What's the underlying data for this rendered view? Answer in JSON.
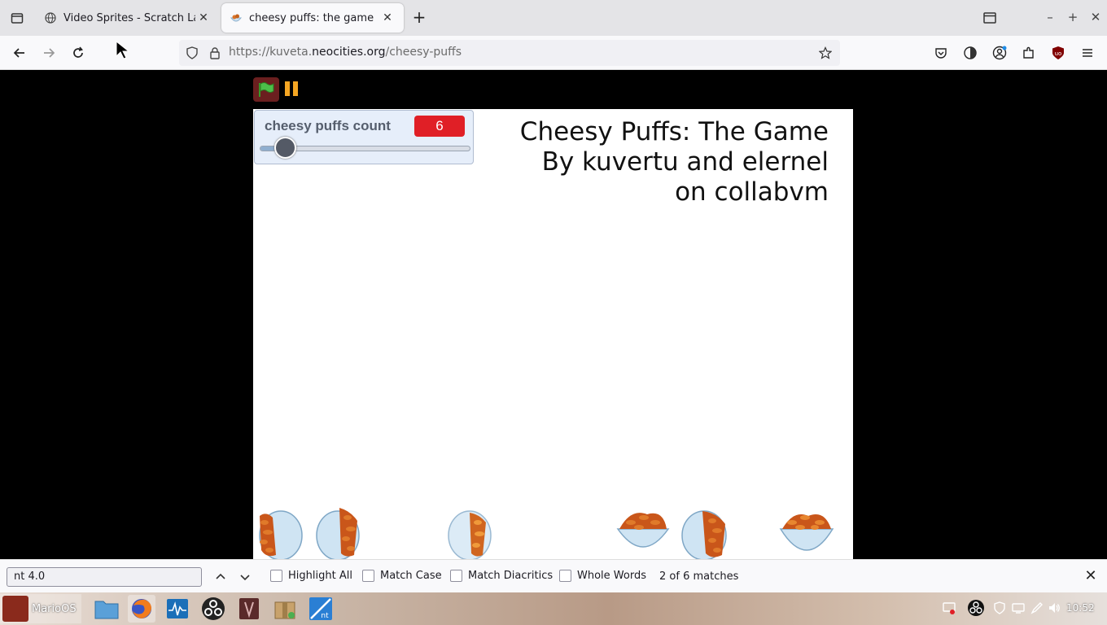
{
  "browser": {
    "tabs": [
      {
        "title": "Video Sprites - Scratch Lab",
        "active": false
      },
      {
        "title": "cheesy puffs: the game",
        "active": true
      }
    ],
    "url_scheme": "https://kuveta.",
    "url_host": "neocities.org",
    "url_path": "/cheesy-puffs"
  },
  "game": {
    "monitor_label": "cheesy puffs count",
    "monitor_value": "6",
    "slider_level": 0.1,
    "title_lines": [
      "Cheesy Puffs: The Game",
      "By kuvertu and elernel",
      "on collabvm"
    ]
  },
  "findbar": {
    "query": "nt 4.0",
    "options": [
      "Highlight All",
      "Match Case",
      "Match Diacritics",
      "Whole Words"
    ],
    "status": "2 of 6 matches"
  },
  "taskbar": {
    "start_label": "MarioOS",
    "clock": "10:52"
  },
  "colors": {
    "accent_red": "#e01f26",
    "flag_green": "#3a9a2a",
    "stop_orange": "#f5a623"
  }
}
